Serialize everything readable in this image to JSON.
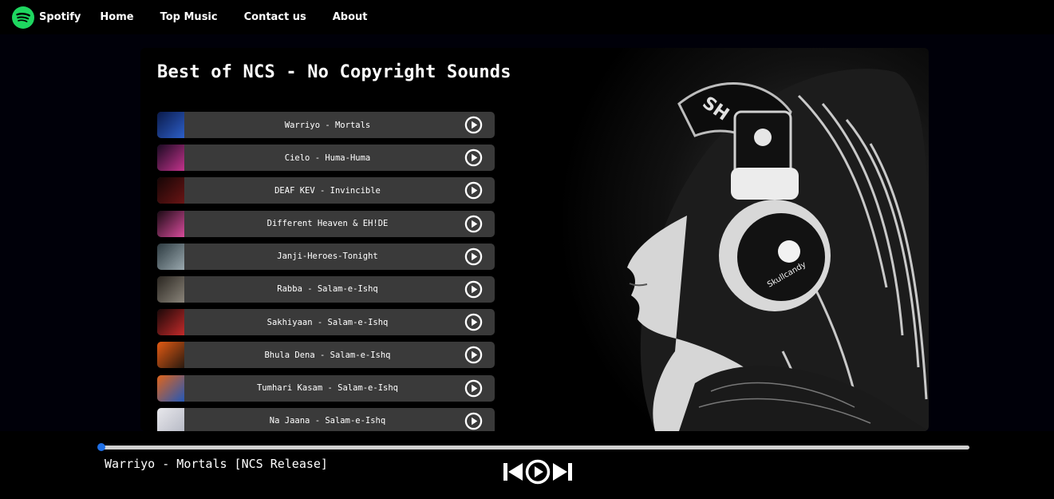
{
  "nav": {
    "brand": "Spotify",
    "links": [
      "Home",
      "Top Music",
      "Contact us",
      "About"
    ]
  },
  "main": {
    "title": "Best of NCS - No Copyright Sounds",
    "songs": [
      {
        "name": "Warriyo - Mortals",
        "cover_colors": [
          "#0a1a4a",
          "#2d5fc9"
        ]
      },
      {
        "name": "Cielo - Huma-Huma",
        "cover_colors": [
          "#1a0a22",
          "#c2338c"
        ]
      },
      {
        "name": "DEAF KEV - Invincible",
        "cover_colors": [
          "#150505",
          "#6a1515"
        ]
      },
      {
        "name": "Different Heaven & EH!DE",
        "cover_colors": [
          "#1a0a14",
          "#d84c9c"
        ]
      },
      {
        "name": "Janji-Heroes-Tonight",
        "cover_colors": [
          "#2c3a40",
          "#9aa8ae"
        ]
      },
      {
        "name": "Rabba - Salam-e-Ishq",
        "cover_colors": [
          "#2a2620",
          "#8a847a"
        ]
      },
      {
        "name": "Sakhiyaan - Salam-e-Ishq",
        "cover_colors": [
          "#1a0808",
          "#c22a2a"
        ]
      },
      {
        "name": "Bhula Dena - Salam-e-Ishq",
        "cover_colors": [
          "#e35a12",
          "#2a1a10"
        ]
      },
      {
        "name": "Tumhari Kasam - Salam-e-Ishq",
        "cover_colors": [
          "#e0641a",
          "#2358b8"
        ]
      },
      {
        "name": "Na Jaana - Salam-e-Ishq",
        "cover_colors": [
          "#e8e8ec",
          "#b5b8c4"
        ]
      }
    ]
  },
  "player": {
    "now_playing": "Warriyo - Mortals [NCS Release]",
    "progress": 0.0,
    "accent_color": "#1f6fe5"
  },
  "colors": {
    "page_bg": "#000009",
    "panel_bg": "#000000",
    "item_bg": "#3a3a3a",
    "brand_green": "#1ed760"
  },
  "icons": {
    "brand": "spotify-logo-icon",
    "play": "play-circle-icon",
    "previous": "skip-previous-icon",
    "next": "skip-next-icon"
  }
}
